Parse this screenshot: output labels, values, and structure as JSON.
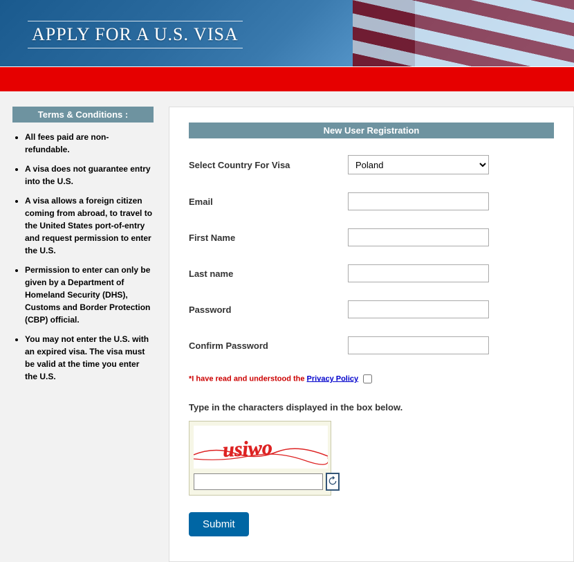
{
  "banner": {
    "title": "APPLY FOR A U.S. VISA"
  },
  "sidebar": {
    "terms_title": "Terms & Conditions :",
    "items": [
      "All fees paid are non-refundable.",
      "A visa does not guarantee entry into the U.S.",
      "A visa allows a foreign citizen coming from abroad, to travel to the United States port-of-entry and request permission to enter the U.S.",
      "Permission to enter can only be given by a Department of Homeland Security (DHS), Customs and Border Protection (CBP) official.",
      "You may not enter the U.S. with an expired visa. The visa must be valid at the time you enter the U.S."
    ]
  },
  "form": {
    "title": "New User Registration",
    "country_label": "Select Country For Visa",
    "country_value": "Poland",
    "email_label": "Email",
    "firstname_label": "First Name",
    "lastname_label": "Last name",
    "password_label": "Password",
    "confirm_label": "Confirm Password",
    "privacy_prefix": "*I have read and understood the ",
    "privacy_link": "Privacy Policy",
    "captcha_label": "Type in the characters displayed in the box below.",
    "captcha_text": "usiwo",
    "submit_label": "Submit"
  }
}
